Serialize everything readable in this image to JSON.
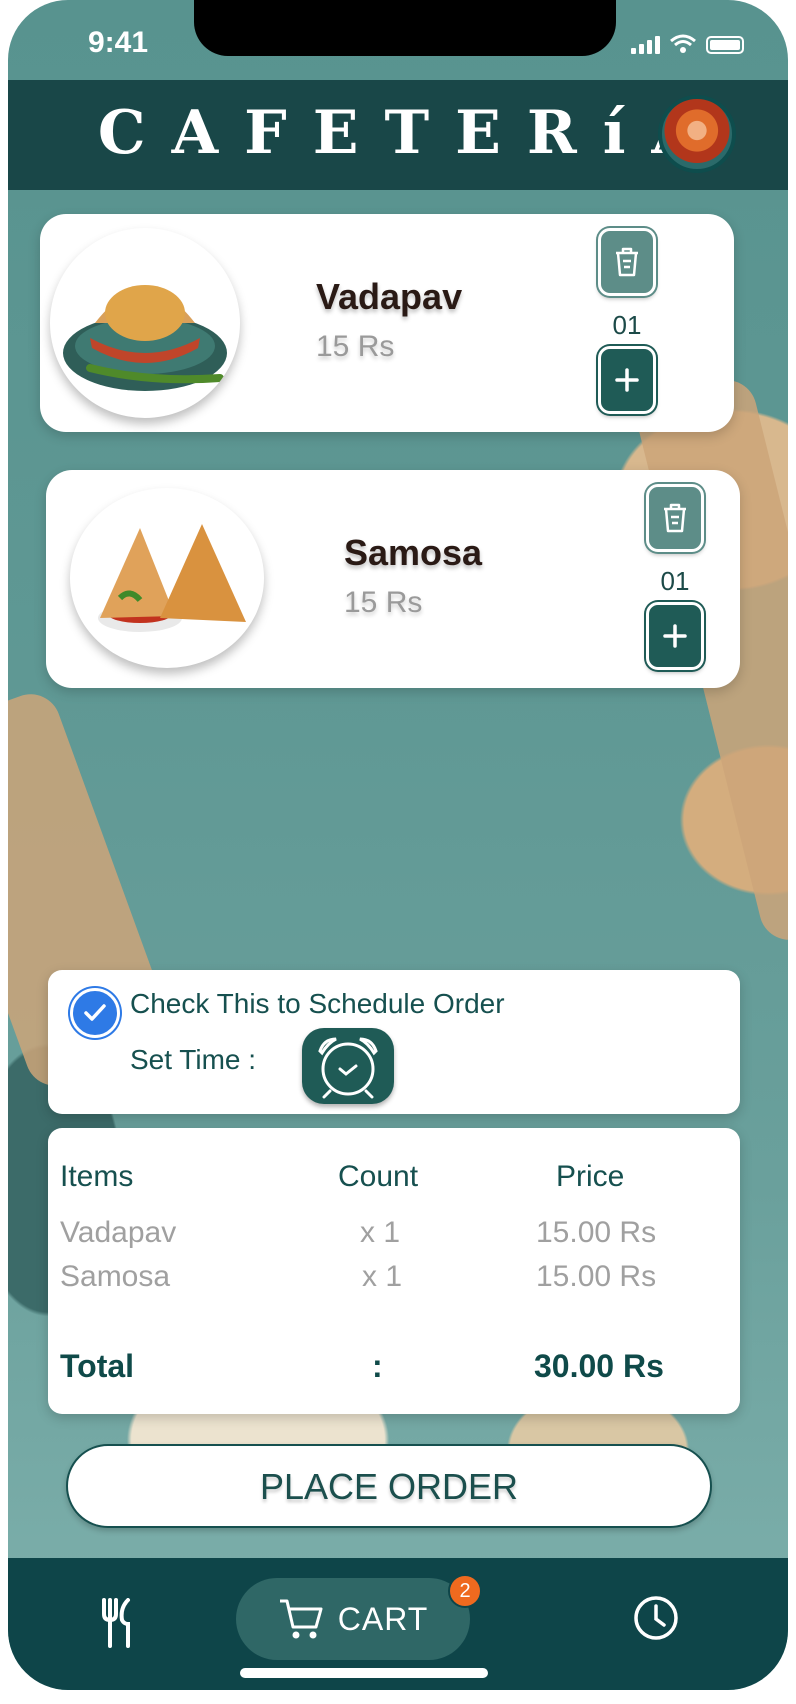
{
  "status_bar": {
    "time": "9:41"
  },
  "header": {
    "title": "CAFETERíA"
  },
  "cart_items": [
    {
      "name": "Vadapav",
      "price": "15 Rs",
      "quantity": "01"
    },
    {
      "name": "Samosa",
      "price": "15 Rs",
      "quantity": "01"
    }
  ],
  "schedule": {
    "checkbox_label": "Check This to Schedule Order",
    "checked": true,
    "set_time_label": "Set Time :"
  },
  "summary": {
    "headers": {
      "items": "Items",
      "count": "Count",
      "price": "Price"
    },
    "rows": [
      {
        "item": "Vadapav",
        "count": "x 1",
        "price": "15.00 Rs"
      },
      {
        "item": "Samosa",
        "count": "x 1",
        "price": "15.00 Rs"
      }
    ],
    "total_label": "Total",
    "separator": ":",
    "total_value": "30.00 Rs"
  },
  "place_order_label": "PLACE ORDER",
  "bottom_nav": {
    "cart_label": "CART",
    "cart_badge": "2"
  },
  "colors": {
    "primary": "#0e4549",
    "accent": "#1f5b56",
    "badge": "#ef6a1f",
    "check": "#2e7ae6"
  }
}
